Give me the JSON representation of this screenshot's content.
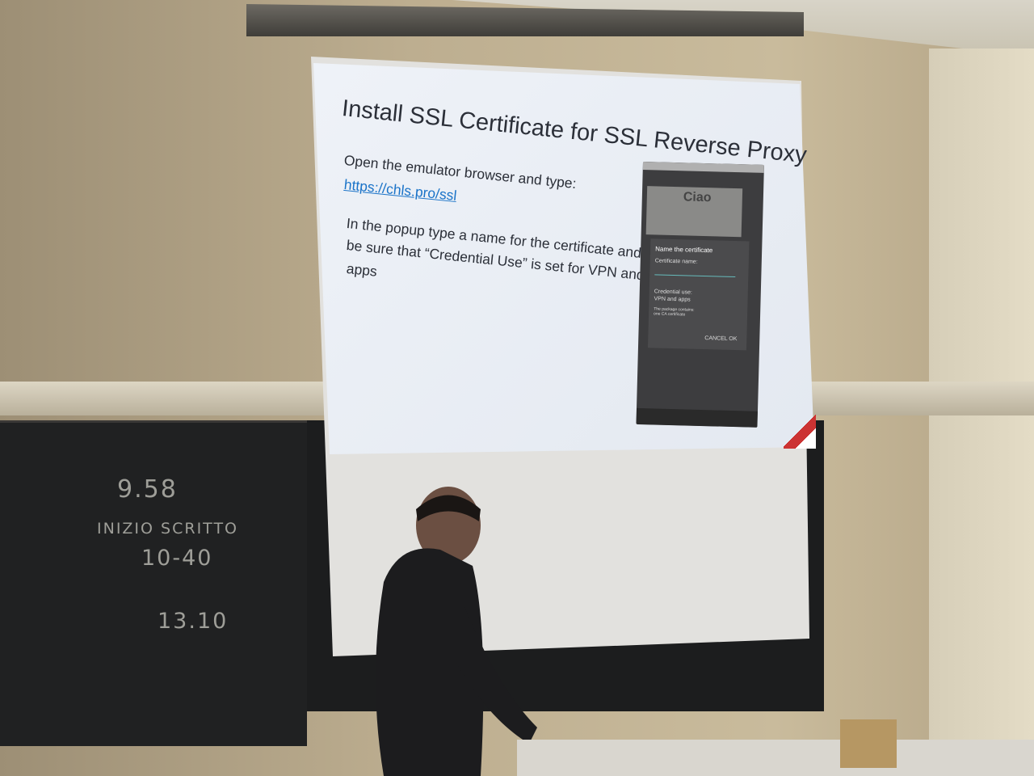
{
  "slide": {
    "title": "Install SSL Certificate for SSL Reverse Proxy",
    "line1": "Open the emulator browser and type:",
    "link": "https://chls.pro/ssl",
    "para2_lines": [
      "In the popup type a name for the certificate and",
      "be sure that “Credential Use” is set for VPN and",
      "apps"
    ]
  },
  "phone": {
    "logo": "Ciao",
    "dialog_title": "Name the certificate",
    "field_label": "Certificate name:",
    "credential_label": "Credential use:",
    "credential_value": "VPN and apps",
    "note": "The package contains: one CA certificate",
    "cancel": "CANCEL",
    "ok": "OK"
  },
  "chalkboard": {
    "lines": [
      "9.58",
      "INIZIO SCRITTO",
      "10-40",
      "13.10"
    ]
  }
}
